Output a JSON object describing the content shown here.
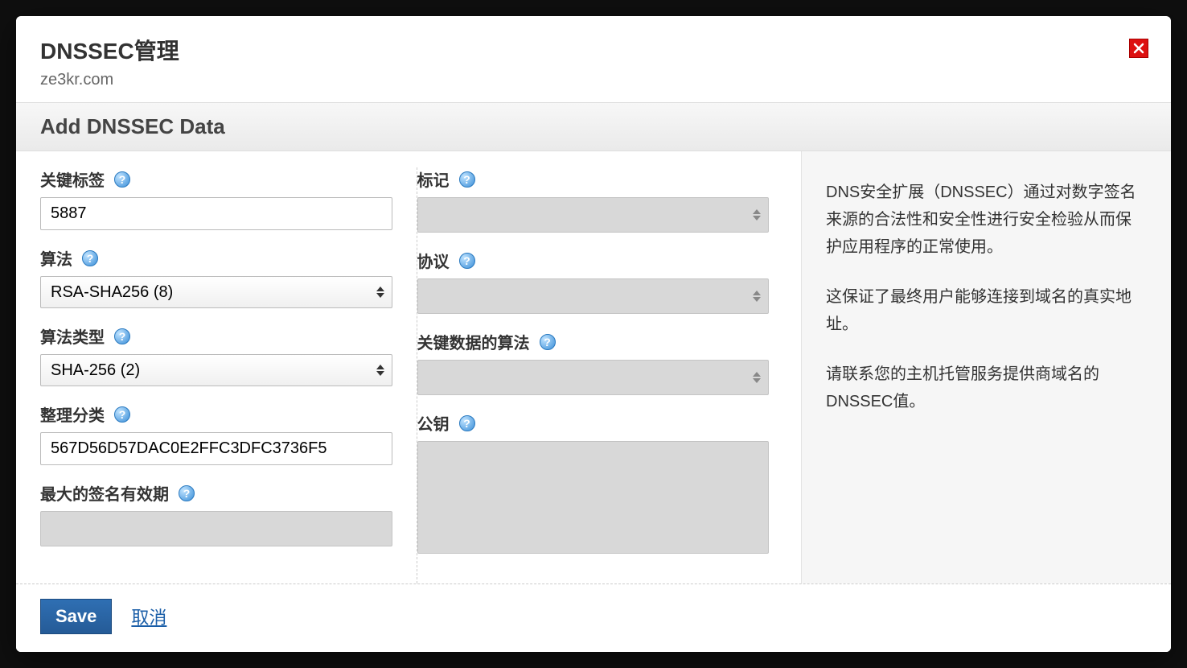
{
  "header": {
    "title": "DNSSEC管理",
    "subtitle": "ze3kr.com"
  },
  "section": {
    "title": "Add DNSSEC Data"
  },
  "left": {
    "key_tag": {
      "label": "关键标签",
      "value": "5887"
    },
    "algorithm": {
      "label": "算法",
      "value": "RSA-SHA256 (8)"
    },
    "algorithm_type": {
      "label": "算法类型",
      "value": "SHA-256 (2)"
    },
    "digest": {
      "label": "整理分类",
      "value": "567D56D57DAC0E2FFC3DFC3736F5"
    },
    "max_sig": {
      "label": "最大的签名有效期",
      "value": ""
    }
  },
  "right": {
    "flag": {
      "label": "标记",
      "value": ""
    },
    "protocol": {
      "label": "协议",
      "value": ""
    },
    "key_algo": {
      "label": "关键数据的算法",
      "value": ""
    },
    "pubkey": {
      "label": "公钥",
      "value": ""
    }
  },
  "sidebar": {
    "p1": "DNS安全扩展（DNSSEC）通过对数字签名来源的合法性和安全性进行安全检验从而保护应用程序的正常使用。",
    "p2": "这保证了最终用户能够连接到域名的真实地址。",
    "p3": "请联系您的主机托管服务提供商域名的DNSSEC值。"
  },
  "footer": {
    "save": "Save",
    "cancel": "取消"
  },
  "help_glyph": "?"
}
